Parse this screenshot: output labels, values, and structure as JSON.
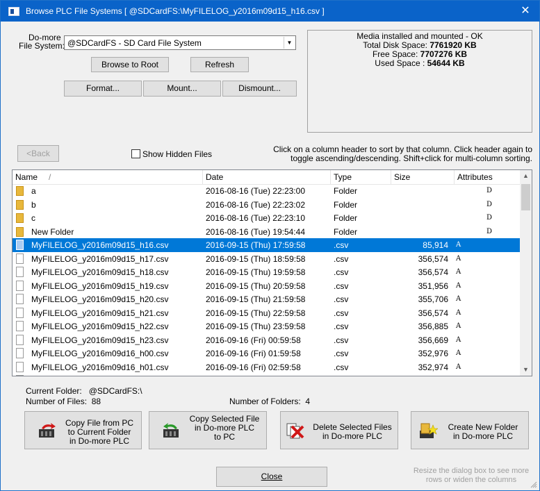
{
  "window": {
    "title": "Browse PLC File Systems [ @SDCardFS:\\MyFILELOG_y2016m09d15_h16.csv ]",
    "close_glyph": "✕"
  },
  "filesystem": {
    "label_line1": "Do-more",
    "label_line2": "File System:",
    "selected": "@SDCardFS - SD Card File System"
  },
  "buttons": {
    "browse_root": "Browse to Root",
    "refresh": "Refresh",
    "format": "Format...",
    "mount": "Mount...",
    "dismount": "Dismount...",
    "back": "<Back",
    "close": "Close"
  },
  "media_info": {
    "status": "Media installed and mounted - OK",
    "total_label": "Total Disk Space:",
    "total_value": "7761920 KB",
    "free_label": "Free Space:",
    "free_value": "7707276 KB",
    "used_label": "Used Space :",
    "used_value": "54644 KB"
  },
  "show_hidden": {
    "label": "Show Hidden Files",
    "checked": false
  },
  "sort_hint": {
    "line1": "Click on a column header to sort by that column.  Click header again to",
    "line2": "toggle ascending/descending.  Shift+click for multi-column sorting."
  },
  "table": {
    "columns": [
      "Name",
      "Date",
      "Type",
      "Size",
      "Attributes"
    ],
    "sort_indicator": "/",
    "rows": [
      {
        "kind": "folder",
        "name": "a",
        "date": "2016-08-16 (Tue) 22:23:00",
        "type": "Folder",
        "size": "",
        "attr": "D",
        "selected": false
      },
      {
        "kind": "folder",
        "name": "b",
        "date": "2016-08-16 (Tue) 22:23:02",
        "type": "Folder",
        "size": "",
        "attr": "D",
        "selected": false
      },
      {
        "kind": "folder",
        "name": "c",
        "date": "2016-08-16 (Tue) 22:23:10",
        "type": "Folder",
        "size": "",
        "attr": "D",
        "selected": false
      },
      {
        "kind": "folder",
        "name": "New Folder",
        "date": "2016-08-16 (Tue) 19:54:44",
        "type": "Folder",
        "size": "",
        "attr": "D",
        "selected": false
      },
      {
        "kind": "file",
        "name": "MyFILELOG_y2016m09d15_h16.csv",
        "date": "2016-09-15 (Thu) 17:59:58",
        "type": ".csv",
        "size": "85,914",
        "attr": "A",
        "selected": true
      },
      {
        "kind": "file",
        "name": "MyFILELOG_y2016m09d15_h17.csv",
        "date": "2016-09-15 (Thu) 18:59:58",
        "type": ".csv",
        "size": "356,574",
        "attr": "A",
        "selected": false
      },
      {
        "kind": "file",
        "name": "MyFILELOG_y2016m09d15_h18.csv",
        "date": "2016-09-15 (Thu) 19:59:58",
        "type": ".csv",
        "size": "356,574",
        "attr": "A",
        "selected": false
      },
      {
        "kind": "file",
        "name": "MyFILELOG_y2016m09d15_h19.csv",
        "date": "2016-09-15 (Thu) 20:59:58",
        "type": ".csv",
        "size": "351,956",
        "attr": "A",
        "selected": false
      },
      {
        "kind": "file",
        "name": "MyFILELOG_y2016m09d15_h20.csv",
        "date": "2016-09-15 (Thu) 21:59:58",
        "type": ".csv",
        "size": "355,706",
        "attr": "A",
        "selected": false
      },
      {
        "kind": "file",
        "name": "MyFILELOG_y2016m09d15_h21.csv",
        "date": "2016-09-15 (Thu) 22:59:58",
        "type": ".csv",
        "size": "356,574",
        "attr": "A",
        "selected": false
      },
      {
        "kind": "file",
        "name": "MyFILELOG_y2016m09d15_h22.csv",
        "date": "2016-09-15 (Thu) 23:59:58",
        "type": ".csv",
        "size": "356,885",
        "attr": "A",
        "selected": false
      },
      {
        "kind": "file",
        "name": "MyFILELOG_y2016m09d15_h23.csv",
        "date": "2016-09-16 (Fri) 00:59:58",
        "type": ".csv",
        "size": "356,669",
        "attr": "A",
        "selected": false
      },
      {
        "kind": "file",
        "name": "MyFILELOG_y2016m09d16_h00.csv",
        "date": "2016-09-16 (Fri) 01:59:58",
        "type": ".csv",
        "size": "352,976",
        "attr": "A",
        "selected": false
      },
      {
        "kind": "file",
        "name": "MyFILELOG_y2016m09d16_h01.csv",
        "date": "2016-09-16 (Fri) 02:59:58",
        "type": ".csv",
        "size": "352,974",
        "attr": "A",
        "selected": false
      },
      {
        "kind": "file",
        "name": "MyFILELOG_y2016m09d16_h02.csv",
        "date": "2016-09-16 (Fri) 03:59:58",
        "type": ".csv",
        "size": "352,974",
        "attr": "A",
        "selected": false
      }
    ]
  },
  "status": {
    "current_folder_label": "Current Folder:",
    "current_folder_value": "@SDCardFS:\\",
    "num_files_label": "Number of Files:",
    "num_files_value": "88",
    "num_folders_label": "Number of Folders:",
    "num_folders_value": "4"
  },
  "actions": {
    "copy_from_pc": [
      "Copy File from PC",
      "to Current Folder",
      "in Do-more PLC"
    ],
    "copy_to_pc": [
      "Copy Selected File",
      "in Do-more PLC",
      "to PC"
    ],
    "delete": [
      "Delete Selected Files",
      "in Do-more PLC"
    ],
    "new_folder": [
      "Create New Folder",
      "in Do-more PLC"
    ]
  },
  "resize_hint": [
    "Resize the dialog box to see more",
    "rows or widen the columns"
  ],
  "colors": {
    "titlebar": "#0a63c9",
    "selection": "#0078d7",
    "folder": "#e8b83c"
  },
  "icons": [
    "app-icon",
    "folder-icon",
    "file-icon",
    "copy-to-plc-icon",
    "copy-to-pc-icon",
    "delete-files-icon",
    "new-folder-icon",
    "resize-grip-icon"
  ]
}
